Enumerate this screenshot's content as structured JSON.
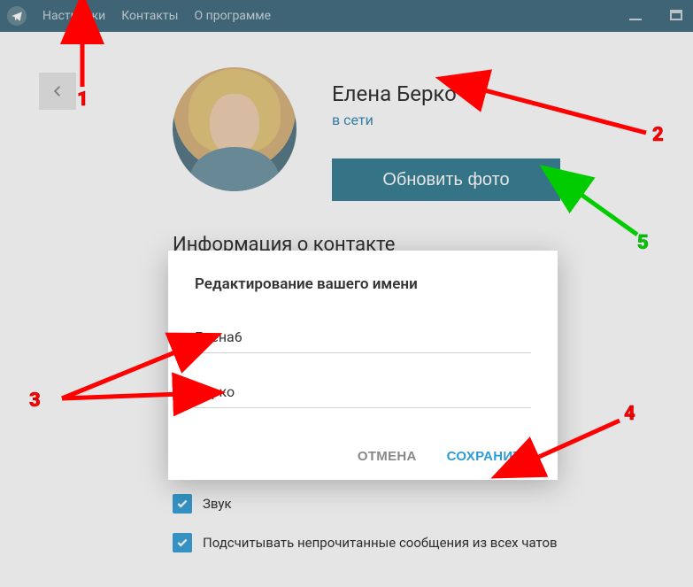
{
  "menu": {
    "items": [
      "Настройки",
      "Контакты",
      "О программе"
    ]
  },
  "profile": {
    "name": "Елена Берко",
    "status": "в сети",
    "update_photo_label": "Обновить фото"
  },
  "section": {
    "contact_info_title": "Информация о контакте"
  },
  "settings": {
    "sound_label": "Звук",
    "count_unread_label": "Подсчитывать непрочитанные сообщения из всех чатов"
  },
  "modal": {
    "title": "Редактирование вашего имени",
    "first_name": "Елена6",
    "last_name": "Берко",
    "cancel_label": "ОТМЕНА",
    "save_label": "СОХРАНИТЬ"
  },
  "annotations": {
    "n1": "1",
    "n2": "2",
    "n3": "3",
    "n4": "4",
    "n5": "5"
  }
}
